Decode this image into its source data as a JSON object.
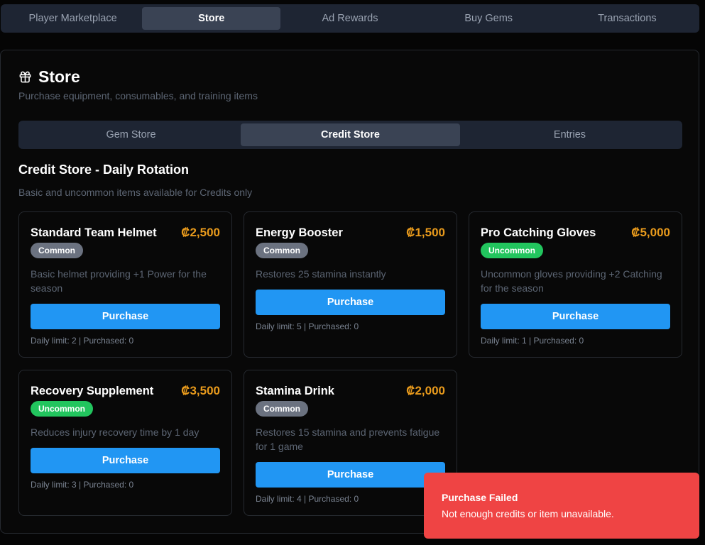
{
  "top_tabs": [
    {
      "label": "Player Marketplace"
    },
    {
      "label": "Store"
    },
    {
      "label": "Ad Rewards"
    },
    {
      "label": "Buy Gems"
    },
    {
      "label": "Transactions"
    }
  ],
  "active_top_tab": "Store",
  "header": {
    "icon": "gift-icon",
    "title": "Store",
    "subtitle": "Purchase equipment, consumables, and training items"
  },
  "sub_tabs": [
    {
      "label": "Gem Store"
    },
    {
      "label": "Credit Store"
    },
    {
      "label": "Entries"
    }
  ],
  "active_sub_tab": "Credit Store",
  "section": {
    "title": "Credit Store - Daily Rotation",
    "subtitle": "Basic and uncommon items available for Credits only"
  },
  "items": [
    {
      "name": "Standard Team Helmet",
      "price": "₡2,500",
      "rarity": "Common",
      "description": "Basic helmet providing +1 Power for the season",
      "button": "Purchase",
      "limit": "Daily limit: 2 | Purchased: 0"
    },
    {
      "name": "Energy Booster",
      "price": "₡1,500",
      "rarity": "Common",
      "description": "Restores 25 stamina instantly",
      "button": "Purchase",
      "limit": "Daily limit: 5 | Purchased: 0"
    },
    {
      "name": "Pro Catching Gloves",
      "price": "₡5,000",
      "rarity": "Uncommon",
      "description": "Uncommon gloves providing +2 Catching for the season",
      "button": "Purchase",
      "limit": "Daily limit: 1 | Purchased: 0"
    },
    {
      "name": "Recovery Supplement",
      "price": "₡3,500",
      "rarity": "Uncommon",
      "description": "Reduces injury recovery time by 1 day",
      "button": "Purchase",
      "limit": "Daily limit: 3 | Purchased: 0"
    },
    {
      "name": "Stamina Drink",
      "price": "₡2,000",
      "rarity": "Common",
      "description": "Restores 15 stamina and prevents fatigue for 1 game",
      "button": "Purchase",
      "limit": "Daily limit: 4 | Purchased: 0"
    }
  ],
  "toast": {
    "title": "Purchase Failed",
    "message": "Not enough credits or item unavailable."
  },
  "colors": {
    "accent_blue": "#2196f3",
    "price_gold": "#e89a1c",
    "common_badge": "#6b7280",
    "uncommon_badge": "#22c55e",
    "error_red": "#ef4444"
  }
}
